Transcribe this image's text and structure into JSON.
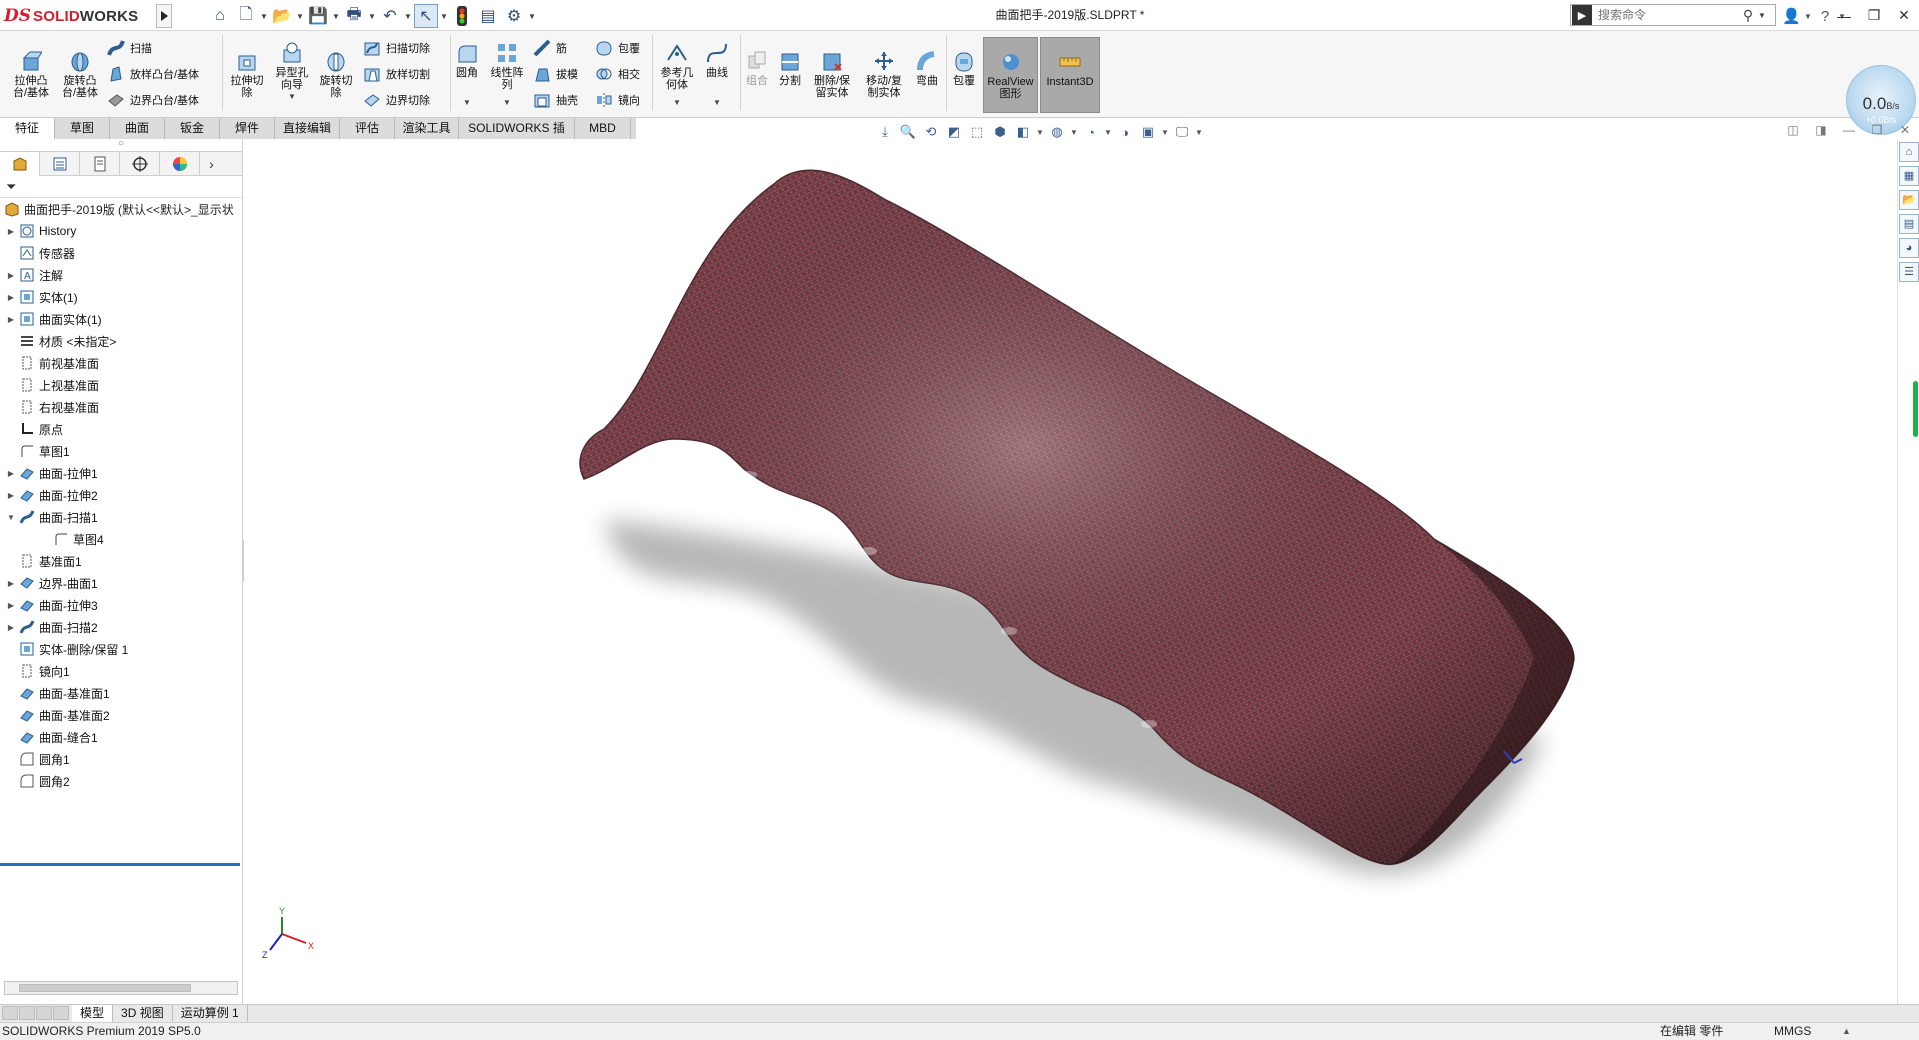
{
  "app": {
    "logo_ds": "DS",
    "logo_solid": "SOLID",
    "logo_works": "WORKS"
  },
  "title": "曲面把手-2019版.SLDPRT *",
  "search": {
    "placeholder": "搜索命令"
  },
  "gauge": {
    "value": "0.0",
    "unit": "B/s",
    "delta": "+0.0B/s"
  },
  "ribbon": {
    "extrude_boss": "拉伸凸\n台/基体",
    "revolve_boss": "旋转凸\n台/基体",
    "sweep": "扫描",
    "loft_boss": "放样凸台/基体",
    "boundary_boss": "边界凸台/基体",
    "extrude_cut": "拉伸切\n除",
    "hole_wizard": "异型孔\n向导",
    "revolve_cut": "旋转切\n除",
    "sweep_cut": "扫描切除",
    "loft_cut": "放样切割",
    "boundary_cut": "边界切除",
    "fillet": "圆角",
    "linear_pattern": "线性阵\n列",
    "rib": "筋",
    "draft": "拔模",
    "shell": "抽壳",
    "wrap": "包覆",
    "intersect": "相交",
    "mirror": "镜向",
    "ref_geometry": "参考几\n何体",
    "curves": "曲线",
    "combine": "组合",
    "split": "分割",
    "delete_keep": "删除/保\n留实体",
    "move_copy": "移动/复\n制实体",
    "flex": "弯曲",
    "wrap2": "包覆",
    "realview": "RealView\n图形",
    "instant3d": "Instant3D"
  },
  "tabs": [
    "特征",
    "草图",
    "曲面",
    "钣金",
    "焊件",
    "直接编辑",
    "评估",
    "渲染工具",
    "SOLIDWORKS 插件",
    "MBD"
  ],
  "tree": {
    "root": "曲面把手-2019版 (默认<<默认>_显示状",
    "items": [
      {
        "label": "History",
        "expand": true
      },
      {
        "label": "传感器",
        "expand": false
      },
      {
        "label": "注解",
        "expand": true
      },
      {
        "label": "实体(1)",
        "expand": true
      },
      {
        "label": "曲面实体(1)",
        "expand": true
      },
      {
        "label": "材质 <未指定>",
        "expand": false
      },
      {
        "label": "前视基准面",
        "expand": false
      },
      {
        "label": "上视基准面",
        "expand": false
      },
      {
        "label": "右视基准面",
        "expand": false
      },
      {
        "label": "原点",
        "expand": false
      },
      {
        "label": "草图1",
        "expand": false
      },
      {
        "label": "曲面-拉伸1",
        "expand": true
      },
      {
        "label": "曲面-拉伸2",
        "expand": true
      },
      {
        "label": "曲面-扫描1",
        "expand": true,
        "open": true
      },
      {
        "label": "草图4",
        "expand": false,
        "child": true
      },
      {
        "label": "基准面1",
        "expand": false
      },
      {
        "label": "边界-曲面1",
        "expand": true
      },
      {
        "label": "曲面-拉伸3",
        "expand": true
      },
      {
        "label": "曲面-扫描2",
        "expand": true
      },
      {
        "label": "实体-删除/保留 1",
        "expand": false
      },
      {
        "label": "镜向1",
        "expand": false
      },
      {
        "label": "曲面-基准面1",
        "expand": false
      },
      {
        "label": "曲面-基准面2",
        "expand": false
      },
      {
        "label": "曲面-缝合1",
        "expand": false
      },
      {
        "label": "圆角1",
        "expand": false
      },
      {
        "label": "圆角2",
        "expand": false
      }
    ]
  },
  "triad": {
    "x": "X",
    "y": "Y",
    "z": "Z"
  },
  "bottom_tabs": [
    "模型",
    "3D 视图",
    "运动算例 1"
  ],
  "status": {
    "product": "SOLIDWORKS Premium 2019 SP5.0",
    "mode": "在编辑 零件",
    "units": "MMGS"
  },
  "colors": {
    "accent": "#1e73be",
    "brand": "#d2202f",
    "model": "#6b3a40"
  }
}
